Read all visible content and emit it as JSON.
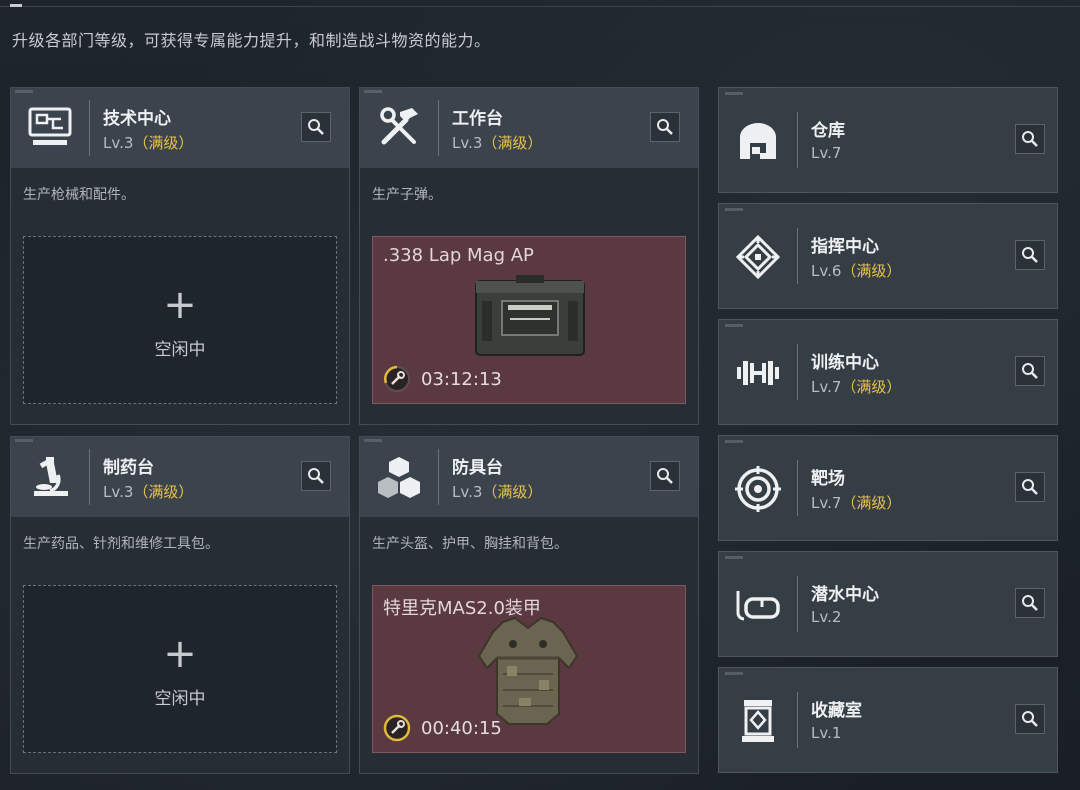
{
  "intro": "升级各部门等级，可获得专属能力提升，和制造战斗物资的能力。",
  "workshops": [
    {
      "title": "技术中心",
      "level": "Lv.3",
      "maxed": "（满级）",
      "desc": "生产枪械和配件。",
      "idle_label": "空闲中",
      "icon": "computer-icon"
    },
    {
      "title": "工作台",
      "level": "Lv.3",
      "maxed": "（满级）",
      "desc": "生产子弹。",
      "item_name": ".338 Lap Mag AP",
      "timer": "03:12:13",
      "icon": "hammer-wrench-icon"
    },
    {
      "title": "制药台",
      "level": "Lv.3",
      "maxed": "（满级）",
      "desc": "生产药品、针剂和维修工具包。",
      "idle_label": "空闲中",
      "icon": "microscope-icon"
    },
    {
      "title": "防具台",
      "level": "Lv.3",
      "maxed": "（满级）",
      "desc": "生产头盔、护甲、胸挂和背包。",
      "item_name": "特里克MAS2.0装甲",
      "timer": "00:40:15",
      "icon": "cubes-icon"
    }
  ],
  "facilities": [
    {
      "title": "仓库",
      "level": "Lv.7",
      "maxed": "",
      "icon": "warehouse-icon"
    },
    {
      "title": "指挥中心",
      "level": "Lv.6",
      "maxed": "（满级）",
      "icon": "command-emblem-icon"
    },
    {
      "title": "训练中心",
      "level": "Lv.7",
      "maxed": "（满级）",
      "icon": "dumbbell-icon"
    },
    {
      "title": "靶场",
      "level": "Lv.7",
      "maxed": "（满级）",
      "icon": "target-icon"
    },
    {
      "title": "潜水中心",
      "level": "Lv.2",
      "maxed": "",
      "icon": "diving-mask-icon"
    },
    {
      "title": "收藏室",
      "level": "Lv.1",
      "maxed": "",
      "icon": "display-case-icon"
    }
  ],
  "colors": {
    "maxed": "#e6c14a",
    "active_slot": "#5a3a40",
    "timer_ring": "#e0b83a"
  }
}
